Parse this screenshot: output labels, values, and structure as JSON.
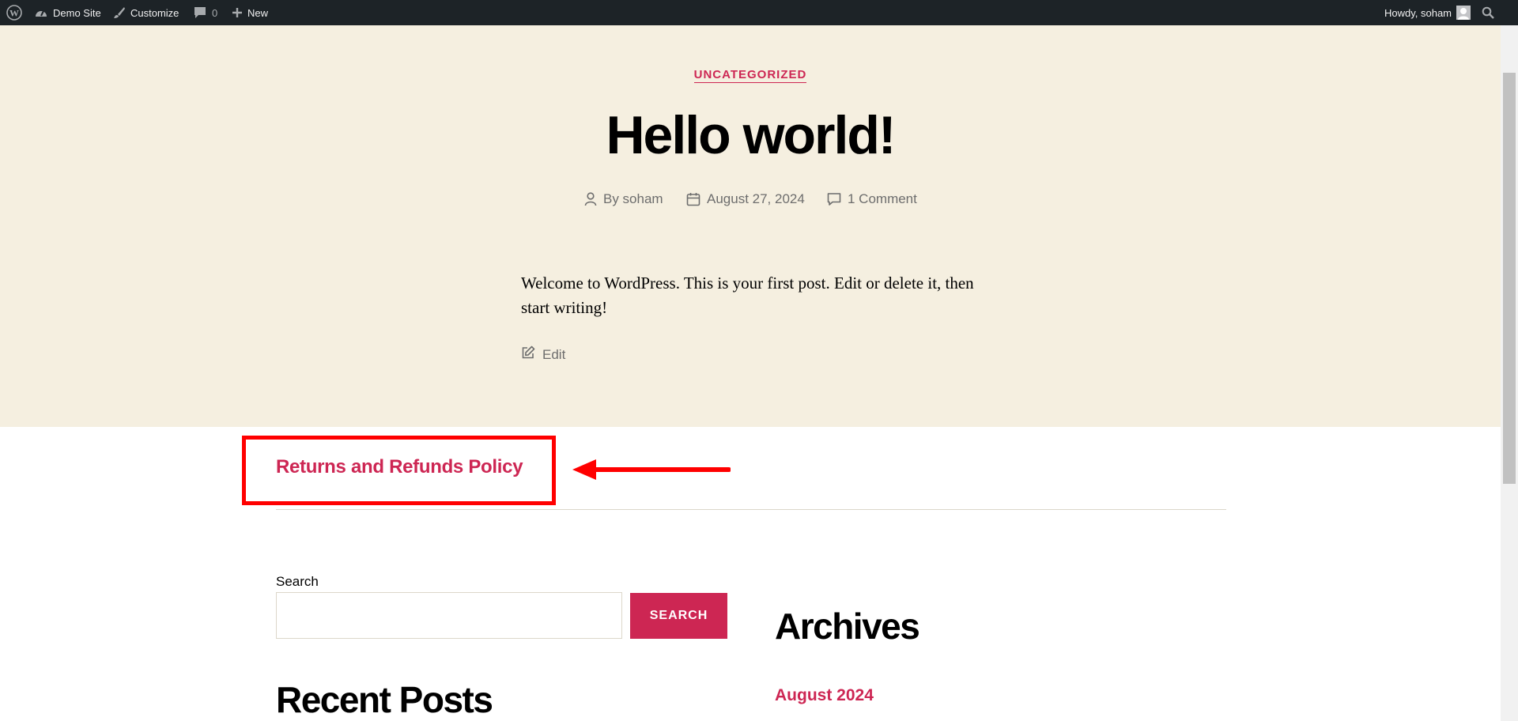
{
  "admin_bar": {
    "site_name": "Demo Site",
    "customize": "Customize",
    "comments_count": "0",
    "new": "New",
    "greeting": "Howdy, soham"
  },
  "post": {
    "category": "UNCATEGORIZED",
    "title": "Hello world!",
    "author": "By soham",
    "date": "August 27, 2024",
    "comments": "1 Comment",
    "body": "Welcome to WordPress. This is your first post. Edit or delete it, then start writing!",
    "edit": "Edit"
  },
  "navigation": {
    "policy_link": "Returns and Refunds Policy"
  },
  "widgets": {
    "search_label": "Search",
    "search_value": "",
    "search_button": "SEARCH",
    "recent_posts_title": "Recent Posts",
    "archives_title": "Archives",
    "archive_item": "August 2024"
  },
  "colors": {
    "accent": "#cd2653",
    "hero_bg": "#f5efe0",
    "admin_bar_bg": "#1d2327",
    "annotation": "#ff0000"
  }
}
